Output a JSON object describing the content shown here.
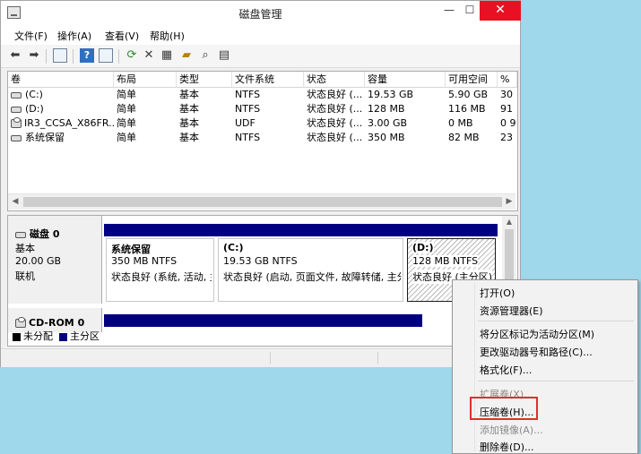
{
  "window": {
    "title": "磁盘管理",
    "minimize_glyph": "—",
    "maximize_glyph": "☐",
    "close_glyph": "✕"
  },
  "menubar": [
    "文件(F)",
    "操作(A)",
    "查看(V)",
    "帮助(H)"
  ],
  "toolbar": {
    "icons": [
      "back-arrow-icon",
      "forward-arrow-icon",
      "properties-list-icon",
      "help-icon",
      "split-view-icon",
      "refresh-icon",
      "delete-icon",
      "properties-icon",
      "open-folder-icon",
      "search-disk-icon",
      "console-icon"
    ],
    "help_glyph": "?"
  },
  "volume_list": {
    "columns": [
      "卷",
      "布局",
      "类型",
      "文件系统",
      "状态",
      "容量",
      "可用空间",
      "%"
    ],
    "rows": [
      [
        "(C:)",
        "简单",
        "基本",
        "NTFS",
        "状态良好 (...",
        "19.53 GB",
        "5.90 GB",
        "30"
      ],
      [
        "(D:)",
        "简单",
        "基本",
        "NTFS",
        "状态良好 (...",
        "128 MB",
        "116 MB",
        "91"
      ],
      [
        "IR3_CCSA_X86FR...",
        "简单",
        "基本",
        "UDF",
        "状态良好 (...",
        "3.00 GB",
        "0 MB",
        "0 9"
      ],
      [
        "系统保留",
        "简单",
        "基本",
        "NTFS",
        "状态良好 (...",
        "350 MB",
        "82 MB",
        "23"
      ]
    ],
    "row_icons": [
      "drive-icon",
      "drive-icon",
      "cd-drive-icon",
      "drive-icon"
    ]
  },
  "disk0": {
    "name": "磁盘 0",
    "type": "基本",
    "size": "20.00 GB",
    "status": "联机",
    "partitions": [
      {
        "title": "系统保留",
        "size": "350 MB NTFS",
        "status": "状态良好 (系统, 活动, 主"
      },
      {
        "title": "(C:)",
        "size": "19.53 GB NTFS",
        "status": "状态良好 (启动, 页面文件, 故障转储, 主分"
      },
      {
        "title": "(D:)",
        "size": "128 MB NTFS",
        "status": "状态良好 (主分区)"
      }
    ]
  },
  "cdrom0": {
    "name": "CD-ROM 0"
  },
  "legend": [
    {
      "label": "未分配",
      "color": "#000000"
    },
    {
      "label": "主分区",
      "color": "#000080"
    }
  ],
  "context_menu": {
    "items": [
      {
        "label": "打开(O)",
        "enabled": true
      },
      {
        "label": "资源管理器(E)",
        "enabled": true
      },
      {
        "label": "将分区标记为活动分区(M)",
        "enabled": true
      },
      {
        "label": "更改驱动器号和路径(C)...",
        "enabled": true
      },
      {
        "label": "格式化(F)...",
        "enabled": true
      },
      {
        "label": "扩展卷(X)...",
        "enabled": false
      },
      {
        "label": "压缩卷(H)...",
        "enabled": true,
        "highlighted": true
      },
      {
        "label": "添加镜像(A)...",
        "enabled": false
      },
      {
        "label": "删除卷(D)...",
        "enabled": true
      }
    ]
  },
  "colors": {
    "primary_partition": "#000080",
    "highlight_box": "#e0302a",
    "close_button": "#e81123"
  }
}
